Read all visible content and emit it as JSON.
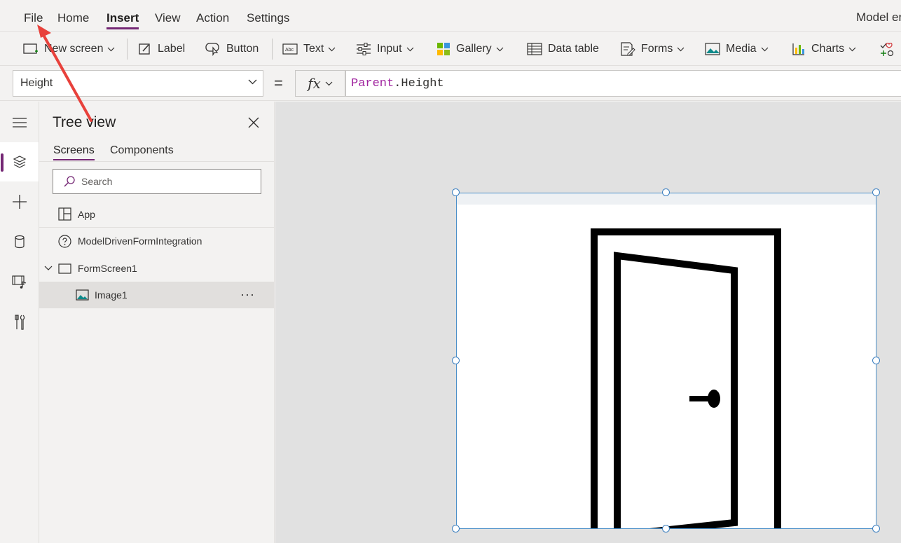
{
  "menu": {
    "items": [
      "File",
      "Home",
      "Insert",
      "View",
      "Action",
      "Settings"
    ],
    "active": "Insert",
    "title_right": "Model er"
  },
  "ribbon": {
    "new_screen": "New screen",
    "label": "Label",
    "button": "Button",
    "text": "Text",
    "input": "Input",
    "gallery": "Gallery",
    "data_table": "Data table",
    "forms": "Forms",
    "media": "Media",
    "charts": "Charts"
  },
  "formula": {
    "property": "Height",
    "equals": "=",
    "fx": "fx",
    "keyword": "Parent",
    "rest": ".Height"
  },
  "tree": {
    "title": "Tree view",
    "tabs": [
      "Screens",
      "Components"
    ],
    "active_tab": "Screens",
    "search_placeholder": "Search",
    "nodes": [
      {
        "label": "App",
        "icon": "app-icon"
      },
      {
        "label": "ModelDrivenFormIntegration",
        "icon": "question-icon"
      },
      {
        "label": "FormScreen1",
        "icon": "screen-icon",
        "expanded": true
      },
      {
        "label": "Image1",
        "icon": "image-icon",
        "selected": true
      }
    ],
    "more_label": "···"
  },
  "canvas": {
    "selected_control": "Image1",
    "image_content": "door-icon"
  },
  "colors": {
    "accent": "#742774",
    "formula_keyword": "#a0249f",
    "selection_border": "#4a8fc9",
    "annotation_arrow": "#e8413b"
  }
}
